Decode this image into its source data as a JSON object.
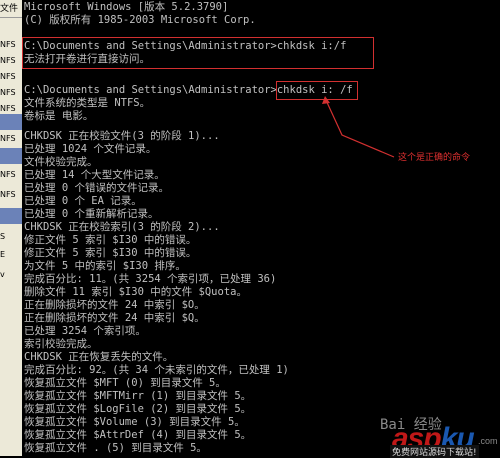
{
  "background_window": {
    "menu_label": "文件",
    "strips": [
      "NFS",
      "NFS",
      "NFS",
      "NFS",
      "NFS",
      "NFS",
      "NFS",
      "NFS",
      "S",
      "E",
      "v"
    ]
  },
  "console": {
    "lines": [
      "Microsoft Windows [版本 5.2.3790]",
      "(C) 版权所有 1985-2003 Microsoft Corp.",
      "",
      "C:\\Documents and Settings\\Administrator>chkdsk i:/f",
      "无法打开卷进行直接访问。",
      "",
      "C:\\Documents and Settings\\Administrator>chkdsk i: /f",
      "文件系统的类型是 NTFS。",
      "卷标是 电影。",
      "",
      "CHKDSK 正在校验文件(3 的阶段 1)...",
      "已处理 1024 个文件记录。",
      "文件校验完成。",
      "已处理 14 个大型文件记录。",
      "已处理 0 个错误的文件记录。",
      "已处理 0 个 EA 记录。",
      "已处理 0 个重新解析记录。",
      "CHKDSK 正在校验索引(3 的阶段 2)...",
      "修正文件 5 索引 $I30 中的错误。",
      "修正文件 5 索引 $I30 中的错误。",
      "为文件 5 中的索引 $I30 排序。",
      "完成百分比: 11。(共 3254 个索引项，已处理 36)",
      "删除文件 11 索引 $I30 中的文件 $Quota。",
      "正在删除损坏的文件 24 中索引 $O。",
      "正在删除损坏的文件 24 中索引 $Q。",
      "已处理 3254 个索引项。",
      "索引校验完成。",
      "CHKDSK 正在恢复丢失的文件。",
      "完成百分比: 92。(共 34 个未索引的文件，已处理 1)",
      "恢复孤立文件 $MFT (0) 到目录文件 5。",
      "恢复孤立文件 $MFTMirr (1) 到目录文件 5。",
      "恢复孤立文件 $LogFile (2) 到目录文件 5。",
      "恢复孤立文件 $Volume (3) 到目录文件 5。",
      "恢复孤立文件 $AttrDef (4) 到目录文件 5。",
      "恢复孤立文件 . (5) 到目录文件 5。"
    ]
  },
  "annotation": {
    "note": "这个是正确的命令"
  },
  "watermark": {
    "baidu": "Bai 经验",
    "asp": "asp",
    "ku": "ku",
    "dotcom": ".com",
    "sub": "免费网站源码下载站!"
  },
  "colors": {
    "console_bg": "#000000",
    "console_text": "#c0c0c0",
    "highlight": "#d23030"
  }
}
